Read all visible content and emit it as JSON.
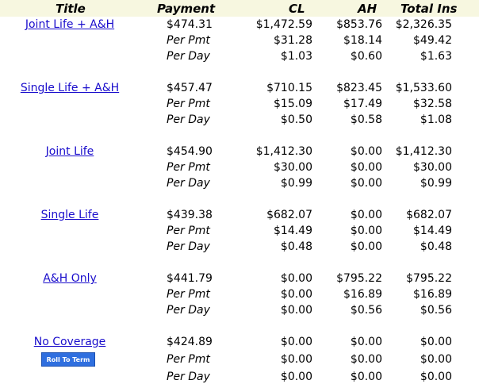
{
  "header": {
    "title": "Title",
    "payment": "Payment",
    "cl": "CL",
    "ah": "AH",
    "total": "Total Ins"
  },
  "groups": [
    {
      "title": "Joint Life + A&H",
      "rows": [
        {
          "pay": "$474.31",
          "cl": "$1,472.59",
          "ah": "$853.76",
          "tot": "$2,326.35"
        },
        {
          "pay": "Per Pmt",
          "cl": "$31.28",
          "ah": "$18.14",
          "tot": "$49.42"
        },
        {
          "pay": "Per Day",
          "cl": "$1.03",
          "ah": "$0.60",
          "tot": "$1.63"
        }
      ]
    },
    {
      "title": "Single Life + A&H",
      "rows": [
        {
          "pay": "$457.47",
          "cl": "$710.15",
          "ah": "$823.45",
          "tot": "$1,533.60"
        },
        {
          "pay": "Per Pmt",
          "cl": "$15.09",
          "ah": "$17.49",
          "tot": "$32.58"
        },
        {
          "pay": "Per Day",
          "cl": "$0.50",
          "ah": "$0.58",
          "tot": "$1.08"
        }
      ]
    },
    {
      "title": "Joint Life",
      "rows": [
        {
          "pay": "$454.90",
          "cl": "$1,412.30",
          "ah": "$0.00",
          "tot": "$1,412.30"
        },
        {
          "pay": "Per Pmt",
          "cl": "$30.00",
          "ah": "$0.00",
          "tot": "$30.00"
        },
        {
          "pay": "Per Day",
          "cl": "$0.99",
          "ah": "$0.00",
          "tot": "$0.99"
        }
      ]
    },
    {
      "title": "Single Life",
      "rows": [
        {
          "pay": "$439.38",
          "cl": "$682.07",
          "ah": "$0.00",
          "tot": "$682.07"
        },
        {
          "pay": "Per Pmt",
          "cl": "$14.49",
          "ah": "$0.00",
          "tot": "$14.49"
        },
        {
          "pay": "Per Day",
          "cl": "$0.48",
          "ah": "$0.00",
          "tot": "$0.48"
        }
      ]
    },
    {
      "title": "A&H Only",
      "rows": [
        {
          "pay": "$441.79",
          "cl": "$0.00",
          "ah": "$795.22",
          "tot": "$795.22"
        },
        {
          "pay": "Per Pmt",
          "cl": "$0.00",
          "ah": "$16.89",
          "tot": "$16.89"
        },
        {
          "pay": "Per Day",
          "cl": "$0.00",
          "ah": "$0.56",
          "tot": "$0.56"
        }
      ]
    },
    {
      "title": "No Coverage",
      "button": "Roll To Term",
      "rows": [
        {
          "pay": "$424.89",
          "cl": "$0.00",
          "ah": "$0.00",
          "tot": "$0.00"
        },
        {
          "pay": "Per Pmt",
          "cl": "$0.00",
          "ah": "$0.00",
          "tot": "$0.00"
        },
        {
          "pay": "Per Day",
          "cl": "$0.00",
          "ah": "$0.00",
          "tot": "$0.00"
        }
      ]
    }
  ],
  "colors": {
    "link": "#1a0dcc",
    "header_bg": "#f7f7e0",
    "button_bg": "#2f6fdf"
  }
}
